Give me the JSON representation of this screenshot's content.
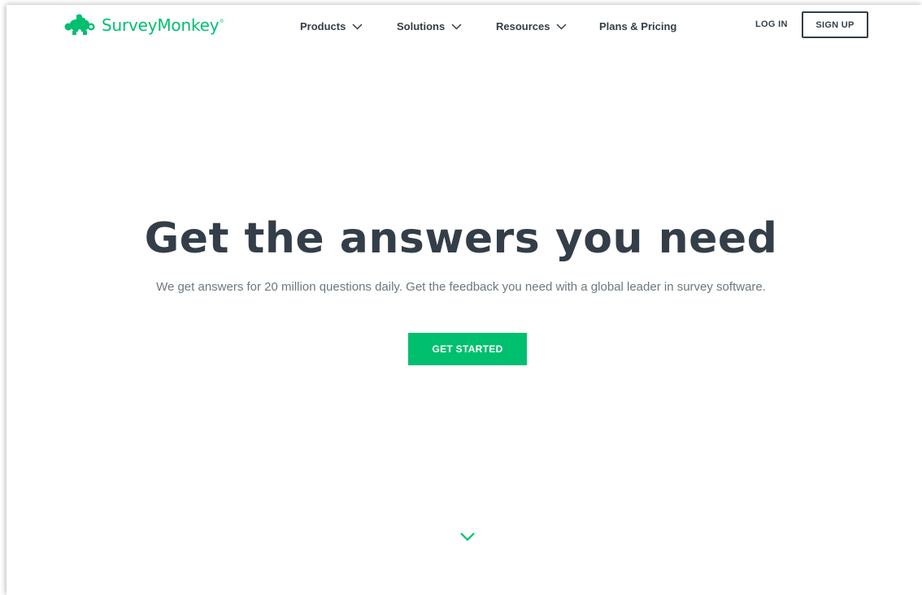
{
  "brand": {
    "name": "SurveyMonkey",
    "registered_mark": "®",
    "color": "#00bf6f"
  },
  "nav": {
    "items": [
      {
        "label": "Products",
        "icon": "chevron-down-icon"
      },
      {
        "label": "Solutions",
        "icon": "chevron-down-icon"
      },
      {
        "label": "Resources",
        "icon": "chevron-down-icon"
      },
      {
        "label": "Plans & Pricing"
      }
    ],
    "login_label": "LOG IN",
    "signup_label": "SIGN UP",
    "text_color": "#333e48"
  },
  "hero": {
    "title": "Get the answers you need",
    "subtitle": "We get answers for 20 million questions daily. Get the feedback you need with a global leader in survey software.",
    "cta_label": "GET STARTED",
    "cta_color": "#00bf6f",
    "scroll_icon": "chevron-down-icon"
  }
}
